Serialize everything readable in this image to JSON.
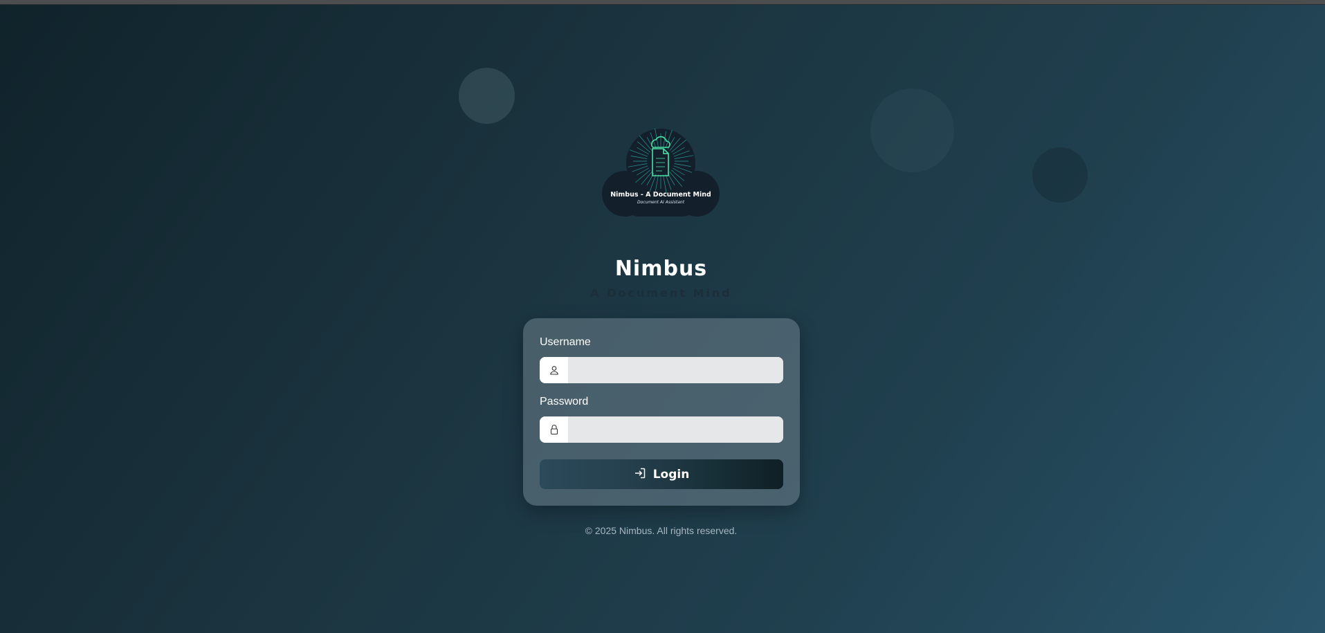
{
  "logo": {
    "title": "Nimbus - A Document Mind",
    "subtitle": "Document AI Assistant",
    "icon": "cloud-document-icon"
  },
  "header": {
    "title": "Nimbus",
    "subtitle": "A Document Mind"
  },
  "form": {
    "username_label": "Username",
    "username_value": "",
    "username_icon": "user-icon",
    "password_label": "Password",
    "password_value": "",
    "password_icon": "lock-icon",
    "login_label": "Login",
    "login_icon": "sign-in-icon"
  },
  "footer": {
    "copyright": "© 2025 Nimbus. All rights reserved."
  },
  "colors": {
    "background_dark": "#10232b",
    "background_light": "#29546a",
    "accent": "#3ecf9a",
    "button_gradient_start": "#2b4a5a",
    "button_gradient_end": "#0f1f25"
  }
}
